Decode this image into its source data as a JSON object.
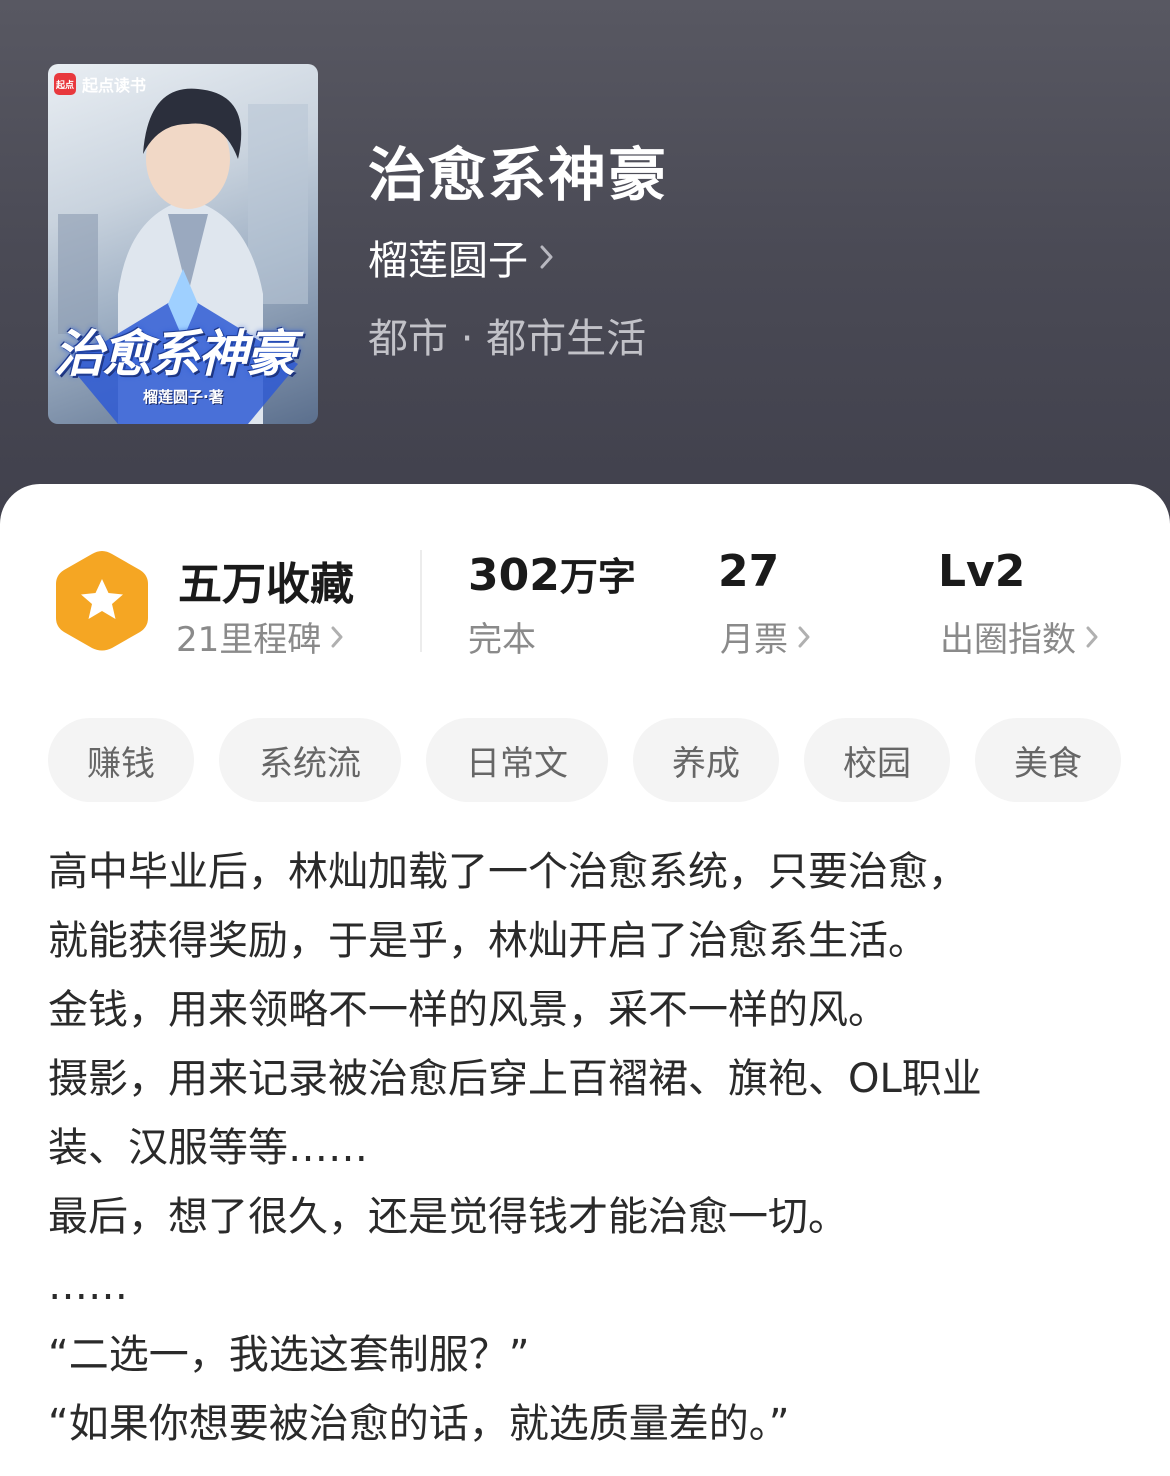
{
  "book": {
    "title": "治愈系神豪",
    "author": "榴莲圆子",
    "genre": "都市 · 都市生活"
  },
  "cover": {
    "brand": "起点读书",
    "brand_mark": "起点",
    "title": "治愈系神豪",
    "author": "榴莲圆子·著"
  },
  "stats": {
    "favorites": {
      "title": "五万收藏",
      "sub": "21里程碑"
    },
    "words": {
      "number": "302",
      "unit": "万字",
      "sub": "完本"
    },
    "monthly_tickets": {
      "title": "27",
      "sub": "月票"
    },
    "influence": {
      "title": "Lv2",
      "sub": "出圈指数"
    }
  },
  "tags": [
    "赚钱",
    "系统流",
    "日常文",
    "养成",
    "校园",
    "美食"
  ],
  "description": [
    "高中毕业后，林灿加载了一个治愈系统，只要治愈，",
    "就能获得奖励，于是乎，林灿开启了治愈系生活。",
    "金钱，用来领略不一样的风景，采不一样的风。",
    "摄影，用来记录被治愈后穿上百褶裙、旗袍、OL职业",
    "装、汉服等等……",
    "最后，想了很久，还是觉得钱才能治愈一切。",
    "……",
    "“二选一，我选这套制服？”",
    "“如果你想要被治愈的话，就选质量差的。”"
  ],
  "colors": {
    "header_bg": "#4a4a55",
    "badge_orange": "#f5a623",
    "tag_bg": "#f4f4f4",
    "muted_text": "#8a8a8a"
  },
  "icons": {
    "badge": "star-hexagon-icon",
    "chevron": "chevron-right-icon"
  }
}
